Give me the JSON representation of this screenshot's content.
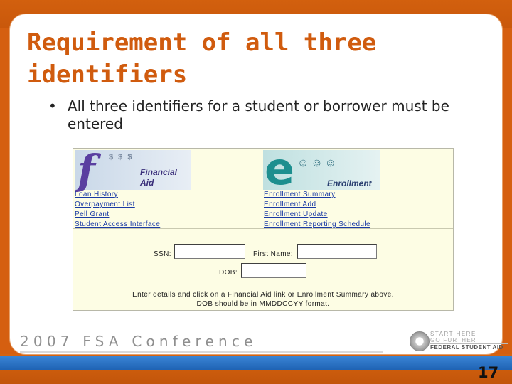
{
  "slide": {
    "title": "Requirement of all three identifiers",
    "bullets": [
      {
        "marker": "•",
        "text": "All three identifiers for a student or borrower must be entered"
      }
    ]
  },
  "app": {
    "financial_aid": {
      "logo_letter": "f",
      "logo_label_1": "Financial",
      "logo_label_2": "Aid",
      "logo_coins": "$ $ $",
      "logo_icon": "financial-aid-logo-icon",
      "links": [
        "Loan History",
        "Overpayment List",
        "Pell Grant",
        "Student Access Interface"
      ]
    },
    "enrollment": {
      "logo_letter": "e",
      "logo_label": "Enrollment",
      "logo_icon": "enrollment-logo-icon",
      "links": [
        "Enrollment Summary",
        "Enrollment Add",
        "Enrollment Update",
        "Enrollment Reporting Schedule"
      ]
    },
    "form": {
      "ssn_label": "SSN:",
      "ssn_value": "",
      "first_name_label": "First Name:",
      "first_name_value": "",
      "dob_label": "DOB:",
      "dob_value": ""
    },
    "instructions": [
      "Enter details and click on a Financial Aid link or Enrollment Summary above.",
      "DOB should be in MMDDCCYY format."
    ]
  },
  "footer": {
    "conference": "2007 FSA Conference",
    "logo_line_1": "START HERE",
    "logo_line_2": "GO FURTHER",
    "logo_line_3": "FEDERAL STUDENT AID",
    "seal_icon": "federal-seal-icon",
    "page_number": "17"
  },
  "colors": {
    "accent_orange": "#d05b0e",
    "band_blue": "#2a72c4",
    "link_blue": "#1a3aa5",
    "app_background": "#fdfde4"
  }
}
